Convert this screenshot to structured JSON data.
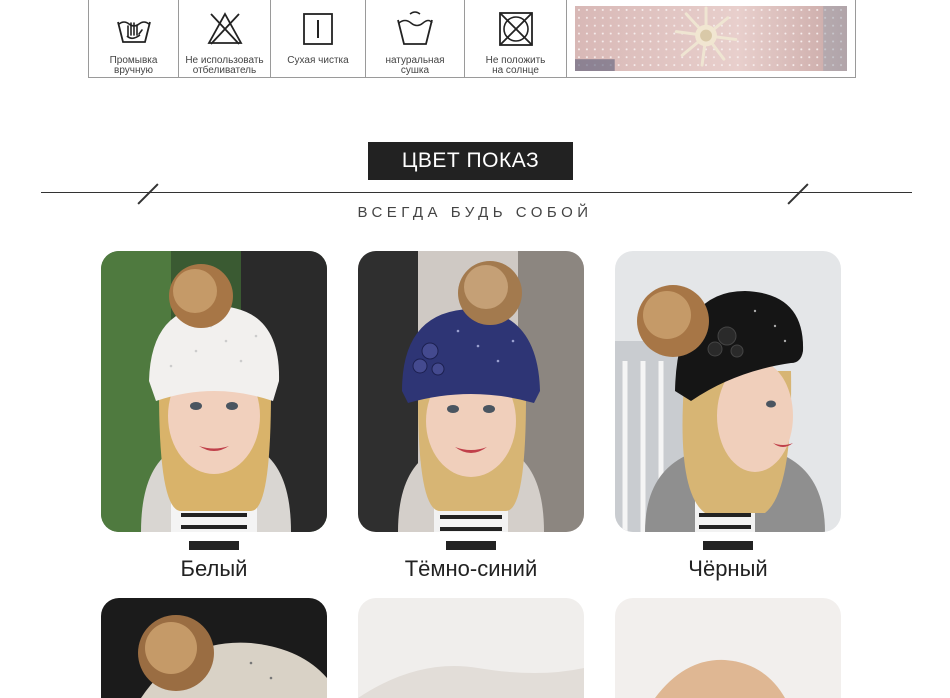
{
  "care": {
    "items": [
      {
        "label": "Промывка\nвручную",
        "icon": "hand-wash-icon"
      },
      {
        "label": "Не использовать\nотбеливатель",
        "icon": "no-bleach-icon"
      },
      {
        "label": "Сухая чистка",
        "icon": "dry-clean-icon"
      },
      {
        "label": "натуральная\nсушка",
        "icon": "natural-dry-icon"
      },
      {
        "label": "Не положить\nна солнце",
        "icon": "no-sun-icon"
      }
    ]
  },
  "section": {
    "title": "ЦВЕТ ПОКАЗ",
    "tagline": "ВСЕГДА БУДЬ СОБОЙ"
  },
  "colors": [
    {
      "label": "Белый",
      "hat_color": "#f2f0ee"
    },
    {
      "label": "Тёмно-синий",
      "hat_color": "#2e3575"
    },
    {
      "label": "Чёрный",
      "hat_color": "#151515"
    }
  ]
}
